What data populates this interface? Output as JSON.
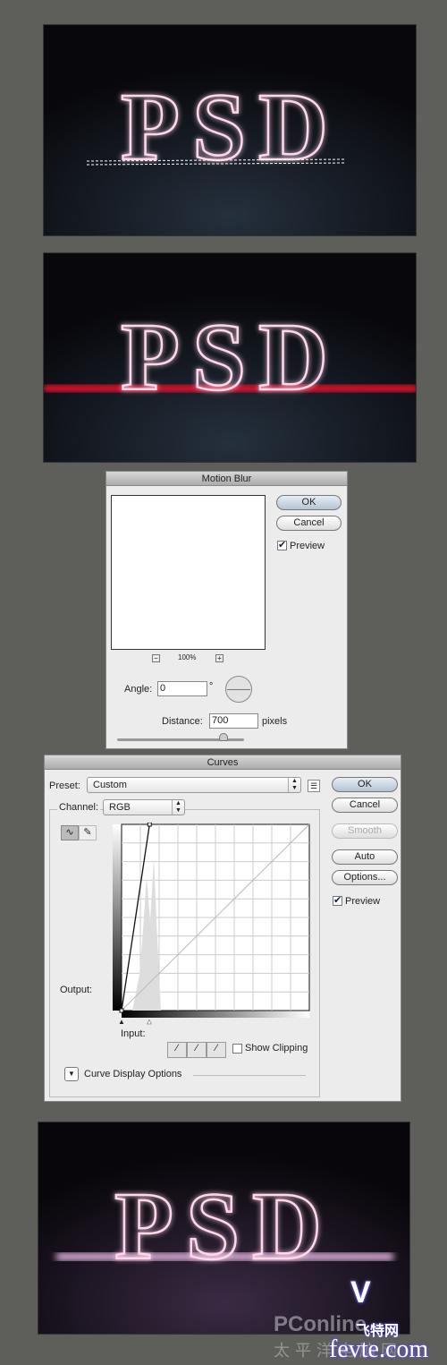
{
  "artwork": {
    "text": "PSD",
    "colors": {
      "glow": "#ff9ad0",
      "stroke": "#ffe6f2",
      "redline": "#e0102a"
    }
  },
  "motion_blur": {
    "title": "Motion Blur",
    "ok": "OK",
    "cancel": "Cancel",
    "preview": "Preview",
    "preview_checked": true,
    "zoom": "100%",
    "zoom_out": "−",
    "zoom_in": "+",
    "angle_label": "Angle:",
    "angle_value": "0",
    "angle_unit": "°",
    "distance_label": "Distance:",
    "distance_value": "700",
    "distance_unit": "pixels"
  },
  "curves": {
    "title": "Curves",
    "preset_label": "Preset:",
    "preset_value": "Custom",
    "channel_label": "Channel:",
    "channel_value": "RGB",
    "ok": "OK",
    "cancel": "Cancel",
    "smooth": "Smooth",
    "auto": "Auto",
    "options": "Options...",
    "preview": "Preview",
    "preview_checked": true,
    "output_label": "Output:",
    "input_label": "Input:",
    "show_clipping": "Show Clipping",
    "show_clipping_checked": false,
    "display_options": "Curve Display Options",
    "curve_points": [
      [
        0,
        0
      ],
      [
        38,
        255
      ]
    ]
  },
  "watermark": {
    "pconline": "PConline",
    "cn": "cn",
    "pconline_cn": "太平洋电脑网",
    "fevte_cn": "飞特网",
    "fevte": "fevte.com"
  }
}
